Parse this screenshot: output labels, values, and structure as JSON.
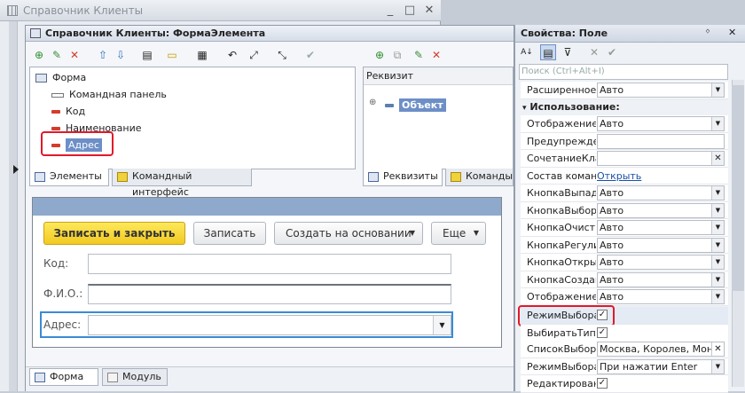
{
  "outer_window": {
    "title": "Справочник Клиенты",
    "minimize": "_",
    "maximize": "□",
    "close": "✕"
  },
  "inner_window": {
    "title": "Справочник Клиенты: ФормаЭлемента"
  },
  "elements_tree": {
    "root": "Форма",
    "items": [
      "Командная панель",
      "Код",
      "Наименование",
      "Адрес"
    ]
  },
  "left_tabs": [
    "Элементы",
    "Командный интерфейс"
  ],
  "requisites": {
    "header": "Реквизит",
    "item": "Объект",
    "tabs": [
      "Реквизиты",
      "Команды"
    ]
  },
  "form_preview": {
    "buttons": {
      "save_close": "Записать и закрыть",
      "save": "Записать",
      "create_basis": "Создать на основании",
      "more": "Еще"
    },
    "fields": [
      {
        "label": "Код:",
        "value": ""
      },
      {
        "label": "Ф.И.О.:",
        "value": ""
      },
      {
        "label": "Адрес:",
        "value": ""
      }
    ]
  },
  "bottom_tabs": [
    "Форма",
    "Модуль"
  ],
  "properties": {
    "title": "Свойства: Поле",
    "pin": "ᛜ",
    "close": "✕",
    "search_placeholder": "Поиск (Ctrl+Alt+I)",
    "section_use": "Использование:",
    "rows": [
      {
        "name": "Расширенное",
        "value": "Авто",
        "kind": "dropdown"
      },
      {
        "name": "Отображение",
        "value": "Авто",
        "kind": "dropdown"
      },
      {
        "name": "Предупрежде",
        "value": "",
        "kind": "text"
      },
      {
        "name": "СочетаниеКла",
        "value": "",
        "kind": "clear"
      },
      {
        "name": "Состав коман",
        "value": "Открыть",
        "kind": "link"
      },
      {
        "name": "КнопкаВыпад",
        "value": "Авто",
        "kind": "dropdown"
      },
      {
        "name": "КнопкаВыбора",
        "value": "Авто",
        "kind": "dropdown"
      },
      {
        "name": "КнопкаОчистк",
        "value": "Авто",
        "kind": "dropdown"
      },
      {
        "name": "КнопкаРегули",
        "value": "Авто",
        "kind": "dropdown"
      },
      {
        "name": "КнопкаОткры",
        "value": "Авто",
        "kind": "dropdown"
      },
      {
        "name": "КнопкаСоздан",
        "value": "Авто",
        "kind": "dropdown"
      },
      {
        "name": "Отображение",
        "value": "Авто",
        "kind": "dropdown"
      },
      {
        "name": "РежимВыбора",
        "value": "✓",
        "kind": "check"
      },
      {
        "name": "ВыбиратьТип",
        "value": "✓",
        "kind": "check"
      },
      {
        "name": "СписокВыбора",
        "value": "Москва, Королев, Мон",
        "kind": "clear"
      },
      {
        "name": "РежимВыбора",
        "value": "При нажатии Enter",
        "kind": "dropdown"
      },
      {
        "name": "Редактирован",
        "value": "✓",
        "kind": "check"
      }
    ]
  }
}
